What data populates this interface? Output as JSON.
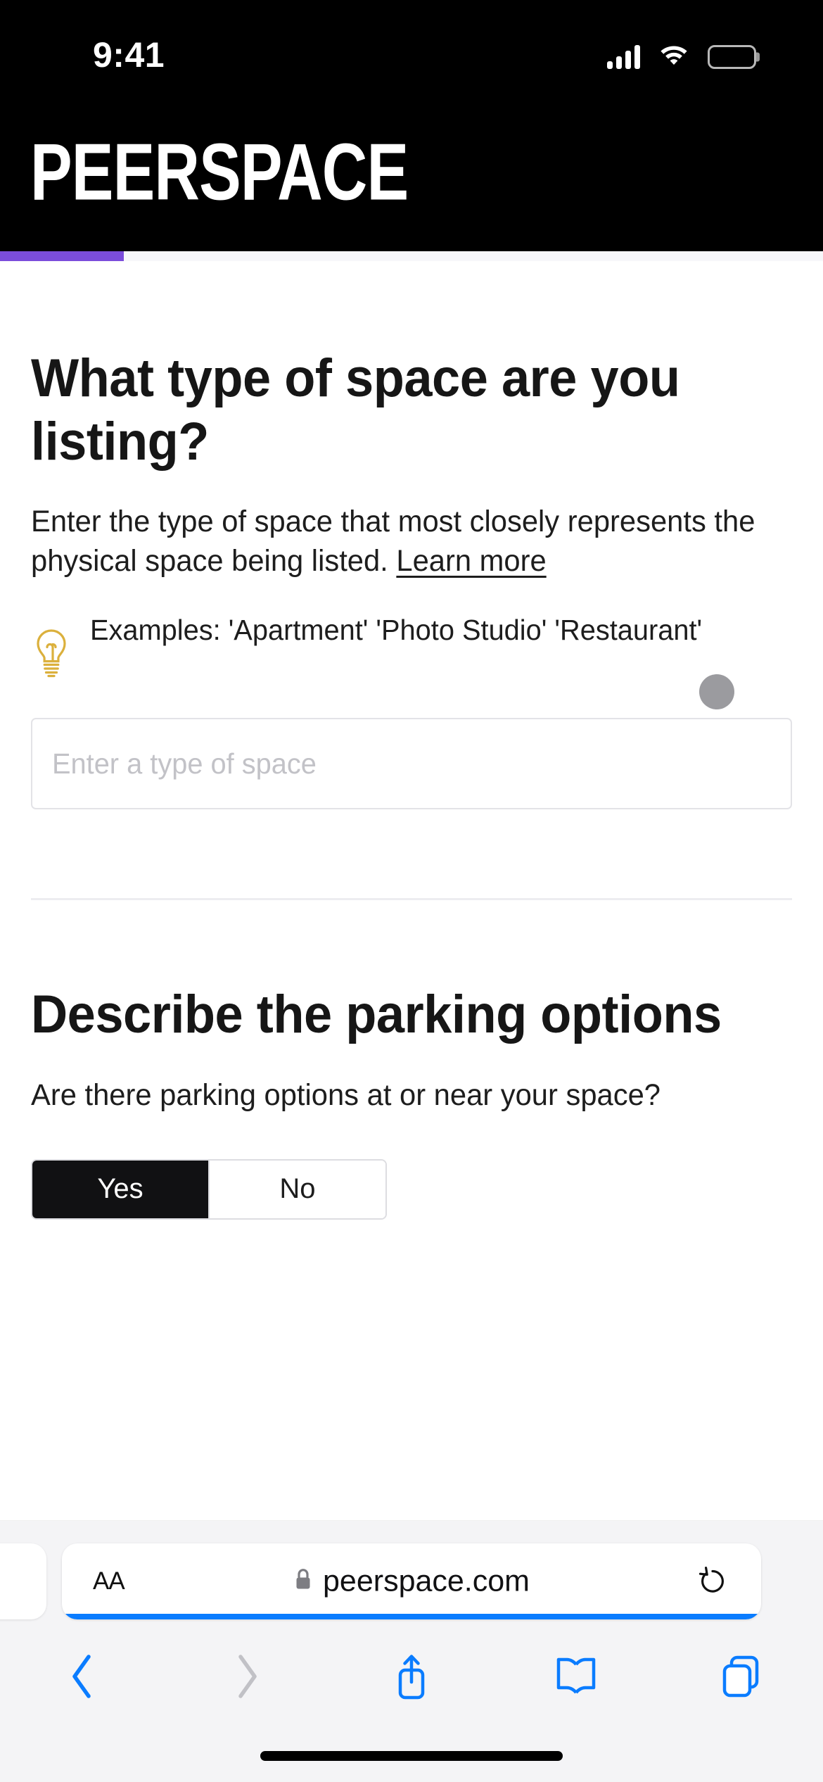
{
  "status_bar": {
    "time": "9:41",
    "cellular_icon": "cellular-signal-icon",
    "wifi_icon": "wifi-icon",
    "battery_icon": "battery-icon"
  },
  "site_header": {
    "brand": "PEERSPACE"
  },
  "progress": {
    "percent": 15,
    "fill_color": "#7b4ddb",
    "track_color": "#f7f7fa"
  },
  "sections": [
    {
      "title": "What type of space are you listing?",
      "description_prefix": "Enter the type of space that most closely represents the physical space being listed.",
      "link_label": "Learn more",
      "hint_icon": "lightbulb-icon",
      "hint_text": "Examples: 'Apartment' 'Photo Studio' 'Restaurant'",
      "input_placeholder": "Enter a type of space",
      "input_value": ""
    },
    {
      "title": "Describe the parking options",
      "description": "Are there parking options at or near your space?",
      "options": [
        {
          "label": "Yes",
          "selected": true
        },
        {
          "label": "No",
          "selected": false
        }
      ]
    }
  ],
  "cursor": {
    "name": "pointer-dot",
    "color": "#9b9b9f"
  },
  "browser": {
    "text_size_label": "AA",
    "lock_icon": "lock-icon",
    "url": "peerspace.com",
    "reload_icon": "reload-icon",
    "load_progress_percent": 100,
    "progress_color": "#0a7cff",
    "toolbar": [
      {
        "name": "back-icon",
        "enabled": true
      },
      {
        "name": "forward-icon",
        "enabled": false
      },
      {
        "name": "share-icon",
        "enabled": true
      },
      {
        "name": "bookmarks-icon",
        "enabled": true
      },
      {
        "name": "tabs-icon",
        "enabled": true
      }
    ],
    "accent_color": "#0a7cff",
    "disabled_color": "#b9b9bf"
  }
}
